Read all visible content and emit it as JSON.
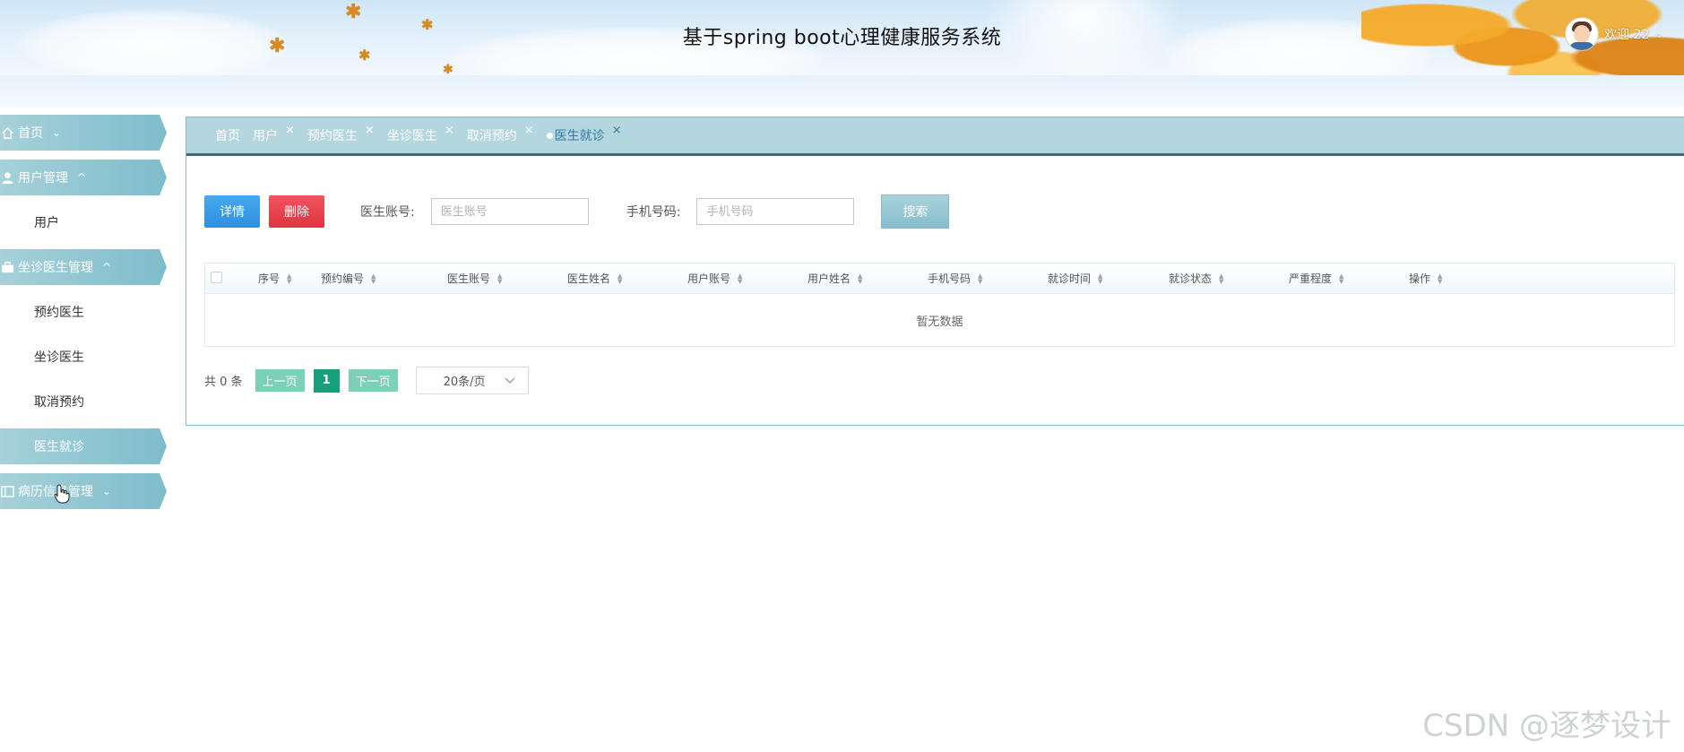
{
  "header": {
    "title": "基于spring boot心理健康服务系统",
    "welcome": "欢迎 22",
    "user_caret": "⌄"
  },
  "sidebar": {
    "items": [
      {
        "label": "首页",
        "icon": "home-icon",
        "caret": "⌄"
      },
      {
        "label": "用户管理",
        "icon": "user-icon",
        "caret": "^"
      },
      {
        "label": "用户"
      },
      {
        "label": "坐诊医生管理",
        "icon": "briefcase-icon",
        "caret": "^"
      },
      {
        "label": "预约医生"
      },
      {
        "label": "坐诊医生"
      },
      {
        "label": "取消预约"
      },
      {
        "label": "医生就诊",
        "active": true
      },
      {
        "label": "病历信息管理",
        "icon": "list-icon",
        "caret": "⌄"
      }
    ]
  },
  "tabs": [
    {
      "label": "首页"
    },
    {
      "label": "用户",
      "close": "×"
    },
    {
      "label": "预约医生",
      "close": "×"
    },
    {
      "label": "坐诊医生",
      "close": "×"
    },
    {
      "label": "取消预约",
      "close": "×"
    },
    {
      "label": "医生就诊",
      "close": "×",
      "active": true
    }
  ],
  "toolbar": {
    "detail_label": "详情",
    "delete_label": "删除",
    "doctor_account_label": "医生账号:",
    "doctor_account_placeholder": "医生账号",
    "phone_label": "手机号码:",
    "phone_placeholder": "手机号码",
    "search_label": "搜索"
  },
  "table": {
    "columns": [
      "序号",
      "预约编号",
      "医生账号",
      "医生姓名",
      "用户账号",
      "用户姓名",
      "手机号码",
      "就诊时间",
      "就诊状态",
      "严重程度",
      "操作"
    ],
    "empty_text": "暂无数据"
  },
  "pagination": {
    "total": "共 0 条",
    "prev": "上一页",
    "page": "1",
    "next": "下一页",
    "page_size": "20条/页"
  },
  "watermark": "CSDN @逐梦设计",
  "colors": {
    "accent": "#7dbcca",
    "tab_bar": "#b4d6de",
    "detail_button": "#2d8fe0",
    "delete_button": "#e03440",
    "page_active": "#18a07b",
    "page_button": "#7cd0b6"
  }
}
